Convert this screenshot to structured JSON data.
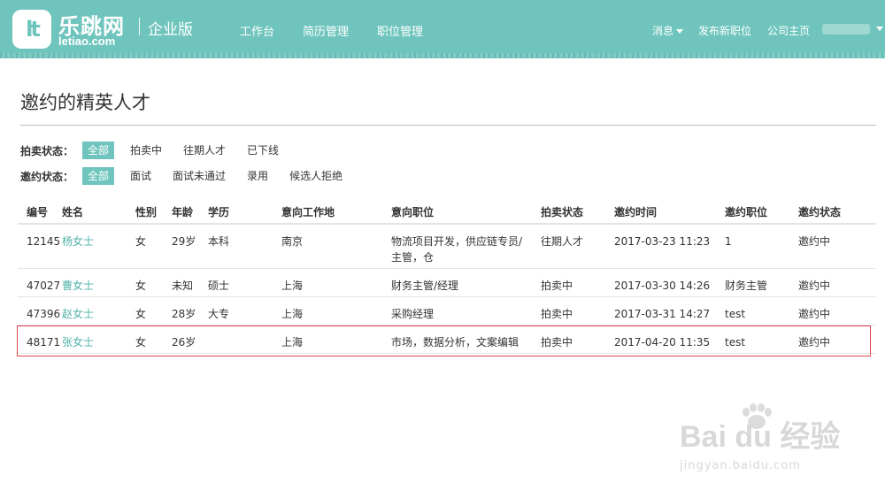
{
  "header": {
    "logo_text": "乐跳网",
    "logo_domain": "letiao.com",
    "edition": "企业版",
    "nav": [
      "工作台",
      "简历管理",
      "职位管理"
    ],
    "right": {
      "messages": "消息",
      "post_job": "发布新职位",
      "company_home": "公司主页"
    },
    "accent_color": "#6fc5bd"
  },
  "page": {
    "title": "邀约的精英人才"
  },
  "filters": {
    "auction": {
      "label": "拍卖状态：",
      "options": [
        "全部",
        "拍卖中",
        "往期人才",
        "已下线"
      ],
      "selected": "全部"
    },
    "invite": {
      "label": "邀约状态：",
      "options": [
        "全部",
        "面试",
        "面试未通过",
        "录用",
        "候选人拒绝"
      ],
      "selected": "全部"
    }
  },
  "table": {
    "columns": [
      "编号",
      "姓名",
      "性别",
      "年龄",
      "学历",
      "意向工作地",
      "意向职位",
      "拍卖状态",
      "邀约时间",
      "邀约职位",
      "邀约状态"
    ],
    "rows": [
      {
        "id": "12145",
        "name": "杨女士",
        "gender": "女",
        "age": "29岁",
        "edu": "本科",
        "city": "南京",
        "position": "物流项目开发，供应链专员/主管，仓",
        "auction": "往期人才",
        "time": "2017-03-23 11:23",
        "invite_job": "1",
        "invite_status": "邀约中"
      },
      {
        "id": "47027",
        "name": "曹女士",
        "gender": "女",
        "age": "未知",
        "edu": "硕士",
        "city": "上海",
        "position": "财务主管/经理",
        "auction": "拍卖中",
        "time": "2017-03-30 14:26",
        "invite_job": "财务主管",
        "invite_status": "邀约中"
      },
      {
        "id": "47396",
        "name": "赵女士",
        "gender": "女",
        "age": "28岁",
        "edu": "大专",
        "city": "上海",
        "position": "采购经理",
        "auction": "拍卖中",
        "time": "2017-03-31 14:27",
        "invite_job": "test",
        "invite_status": "邀约中"
      },
      {
        "id": "48171",
        "name": "张女士",
        "gender": "女",
        "age": "26岁",
        "edu": "",
        "city": "上海",
        "position": "市场，数据分析，文案编辑",
        "auction": "拍卖中",
        "time": "2017-04-20 11:35",
        "invite_job": "test",
        "invite_status": "邀约中"
      }
    ]
  },
  "watermark": {
    "main": "Bai du 经验",
    "sub": "jingyan.baidu.com"
  }
}
